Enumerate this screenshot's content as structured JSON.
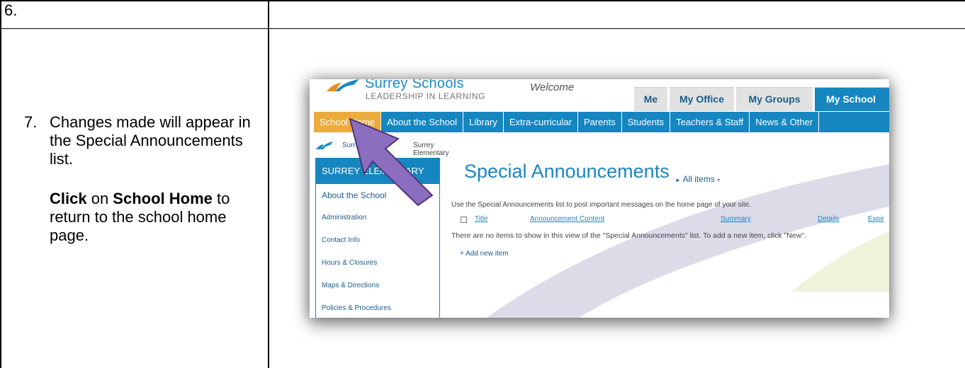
{
  "doc": {
    "step6_label": "6.",
    "step7_number": "7.",
    "step7_text": "Changes made will appear in the Special Announcements list.",
    "click_word": "Click",
    "on_word": " on ",
    "target_word": "School Home",
    "return_text": " to return to the school home page."
  },
  "site": {
    "brand": "Surrey Schools",
    "tagline": "LEADERSHIP IN LEARNING",
    "welcome": "Welcome",
    "tabs": [
      "Me",
      "My Office",
      "My Groups",
      "My School"
    ],
    "nav": [
      "School Home",
      "About the School",
      "Library",
      "Extra-curricular",
      "Parents",
      "Students",
      "Teachers & Staff",
      "News & Other"
    ],
    "breadcrumb": [
      "Surrey",
      "Surrey Elementary"
    ],
    "sidebar_title": "SURREY ELEMENTARY",
    "sidebar_items": [
      "About the School",
      "Administration",
      "Contact Info",
      "Hours & Closures",
      "Maps & Directions",
      "Policies & Procedures"
    ],
    "list_title": "Special Announcements",
    "view_label": "All items",
    "description": "Use the Special Announcements list to post important messages on the home page of your site.",
    "columns": [
      "Title",
      "Announcement Content",
      "Summary",
      "Details",
      "Expir"
    ],
    "empty_message": "There are no items to show in this view of the \"Special Announcements\" list. To add a new item, click \"New\".",
    "add_new": "+ Add new item"
  }
}
